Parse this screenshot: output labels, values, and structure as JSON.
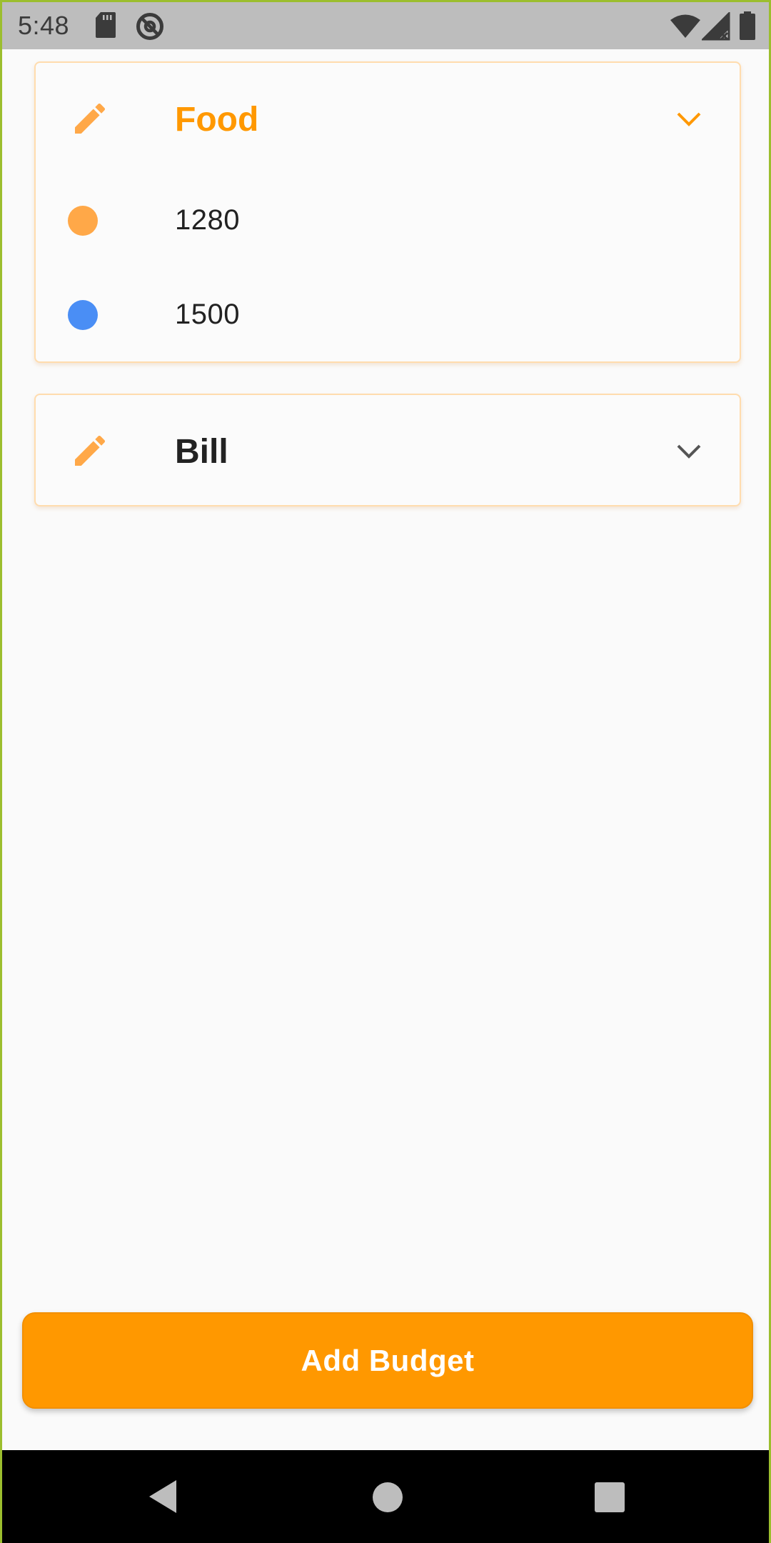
{
  "status_bar": {
    "time": "5:48",
    "left_icons": [
      "sd-card-icon",
      "at-sign-icon"
    ],
    "right_icons": [
      "wifi-icon",
      "signal-icon",
      "battery-icon"
    ]
  },
  "theme": {
    "accent": "#ff9800",
    "accent_light": "#ffa848",
    "series_colors": [
      "#ffa848",
      "#4a8ef5"
    ],
    "text_dark": "#222222"
  },
  "categories": [
    {
      "name": "Food",
      "expanded": true,
      "title_color": "#ff9800",
      "chevron_color": "#ff9800",
      "rows": [
        {
          "value": "1280",
          "dot_color": "#ffa848"
        },
        {
          "value": "1500",
          "dot_color": "#4a8ef5"
        }
      ]
    },
    {
      "name": "Bill",
      "expanded": false,
      "title_color": "#222222",
      "chevron_color": "#555555"
    }
  ],
  "add_button": {
    "label": "Add Budget",
    "color": "#ff9800"
  },
  "nav_bar": {
    "buttons": [
      "back-icon",
      "home-icon",
      "recents-icon"
    ]
  }
}
